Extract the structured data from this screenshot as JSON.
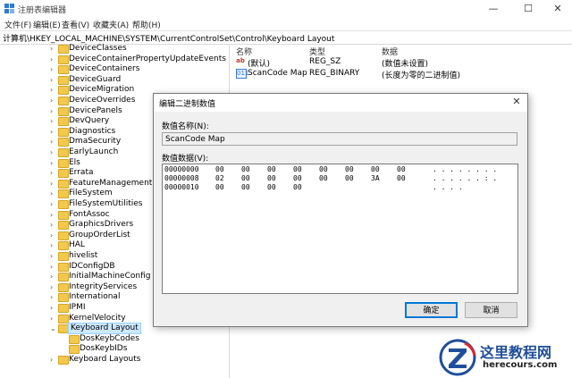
{
  "window": {
    "title": "注册表编辑器",
    "controls": [
      "—",
      "☐",
      "✕"
    ]
  },
  "menu": [
    "文件(F)",
    "编辑(E)",
    "查看(V)",
    "收藏夹(A)",
    "帮助(H)"
  ],
  "address": "计算机\\HKEY_LOCAL_MACHINE\\SYSTEM\\CurrentControlSet\\Control\\Keyboard Layout",
  "tree": {
    "items": [
      {
        "label": "DeviceClasses",
        "expandable": true
      },
      {
        "label": "DeviceContainerPropertyUpdateEvents",
        "expandable": true
      },
      {
        "label": "DeviceContainers",
        "expandable": true
      },
      {
        "label": "DeviceGuard",
        "expandable": true
      },
      {
        "label": "DeviceMigration",
        "expandable": true
      },
      {
        "label": "DeviceOverrides",
        "expandable": true
      },
      {
        "label": "DevicePanels",
        "expandable": true
      },
      {
        "label": "DevQuery",
        "expandable": true
      },
      {
        "label": "Diagnostics",
        "expandable": true
      },
      {
        "label": "DmaSecurity",
        "expandable": true
      },
      {
        "label": "EarlyLaunch",
        "expandable": true
      },
      {
        "label": "Els",
        "expandable": true
      },
      {
        "label": "Errata",
        "expandable": true
      },
      {
        "label": "FeatureManagement",
        "expandable": true
      },
      {
        "label": "FileSystem",
        "expandable": true
      },
      {
        "label": "FileSystemUtilities",
        "expandable": true
      },
      {
        "label": "FontAssoc",
        "expandable": true
      },
      {
        "label": "GraphicsDrivers",
        "expandable": true
      },
      {
        "label": "GroupOrderList",
        "expandable": true
      },
      {
        "label": "HAL",
        "expandable": true
      },
      {
        "label": "hivelist",
        "expandable": true
      },
      {
        "label": "IDConfigDB",
        "expandable": true
      },
      {
        "label": "InitialMachineConfig",
        "expandable": true
      },
      {
        "label": "IntegrityServices",
        "expandable": true
      },
      {
        "label": "International",
        "expandable": true
      },
      {
        "label": "IPMI",
        "expandable": true
      },
      {
        "label": "KernelVelocity",
        "expandable": true
      },
      {
        "label": "Keyboard Layout",
        "expandable": true,
        "expanded": true,
        "selected": true
      },
      {
        "label": "DosKeybCodes",
        "child": true
      },
      {
        "label": "DosKeybIDs",
        "child": true
      },
      {
        "label": "Keyboard Layouts",
        "expandable": true
      }
    ]
  },
  "values": {
    "headers": {
      "name": "名称",
      "type": "类型",
      "data": "数据"
    },
    "rows": [
      {
        "icon": "ab",
        "icon_text": "ab",
        "name": "(默认)",
        "type": "REG_SZ",
        "data": "(数值未设置)"
      },
      {
        "icon": "bin",
        "icon_text": "011",
        "name": "ScanCode Map",
        "type": "REG_BINARY",
        "data": "(长度为零的二进制值)"
      }
    ]
  },
  "dialog": {
    "title": "编辑二进制数值",
    "close": "✕",
    "name_label": "数值名称(N):",
    "name_value": "ScanCode Map",
    "data_label": "数值数据(V):",
    "hex_lines": [
      {
        "offset": "00000000",
        "bytes": [
          "00",
          "00",
          "00",
          "00",
          "00",
          "00",
          "00",
          "00"
        ],
        "ascii": ". . . . . . . ."
      },
      {
        "offset": "00000008",
        "bytes": [
          "02",
          "00",
          "00",
          "00",
          "00",
          "00",
          "3A",
          "00"
        ],
        "ascii": ". . . . . . : ."
      },
      {
        "offset": "00000010",
        "bytes": [
          "00",
          "00",
          "00",
          "00"
        ],
        "ascii": ". . . ."
      }
    ],
    "ok_label": "确定",
    "cancel_label": "取消"
  },
  "watermark": {
    "title": "这里教程网",
    "url": "herecours.com"
  }
}
